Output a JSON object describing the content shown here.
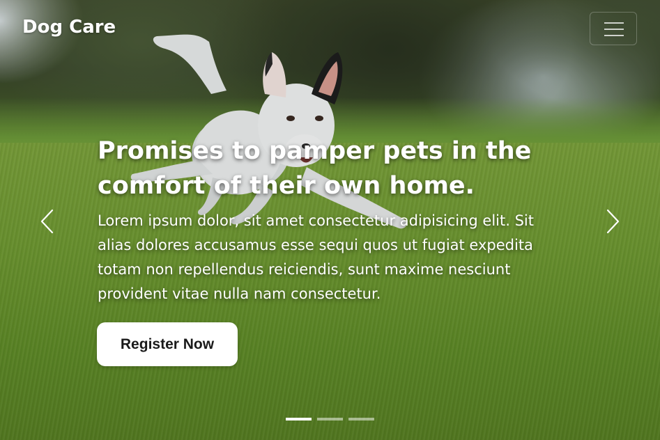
{
  "navbar": {
    "brand": "Dog Care",
    "toggler_icon": "hamburger-menu-icon"
  },
  "hero": {
    "headline_line1": "Promises to pamper pets in the",
    "headline_line2": "comfort of their own home.",
    "lead": "Lorem ipsum dolor, sit amet consectetur adipisicing elit. Sit alias dolores accusamus esse sequi quos ut fugiat expedita totam non repellendus reiciendis, sunt maxime nesciunt provident vitae nulla nam consectetur.",
    "cta_label": "Register Now"
  },
  "carousel": {
    "prev_icon": "chevron-left-icon",
    "next_icon": "chevron-right-icon",
    "slide_count": 3,
    "active_slide": 1
  },
  "colors": {
    "text": "#ffffff",
    "button_bg": "#ffffff",
    "button_text": "#1a1a1a",
    "grass": "#6f9a31"
  }
}
